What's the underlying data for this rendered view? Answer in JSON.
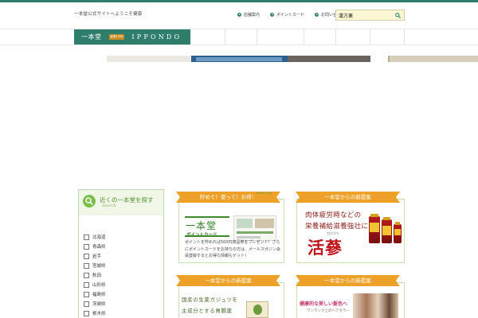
{
  "header": {
    "tagline": "一本堂公式サイトへようこそ健康",
    "links": [
      {
        "label": "店舗案内",
        "icon": "arrow-circle-icon"
      },
      {
        "label": "ポイントカード",
        "icon": "arrow-circle-icon"
      },
      {
        "label": "お問い合わせ",
        "icon": "arrow-circle-icon"
      }
    ],
    "search": {
      "value": "漢方薬",
      "icon": "search-icon"
    }
  },
  "nav": {
    "logo_kanji": "一本堂",
    "logo_since": "創業1958",
    "logo_latin": "IPPONDO",
    "items": [
      "",
      "",
      "",
      "",
      "",
      "",
      ""
    ]
  },
  "sidebar": {
    "title": "近くの一本堂を探す",
    "subtitle": "Search",
    "stores": [
      "北海道",
      "青森県",
      "岩手",
      "宮城県",
      "秋田",
      "山形県",
      "福島県",
      "茨城県",
      "栃木県"
    ]
  },
  "cards": {
    "point": {
      "ribbon": "貯めて！使って！お得！",
      "ribbon_tag": "Point Card",
      "logo_big": "一本堂",
      "logo_small": "ポイントカード",
      "body": "ポイントを貯めれば500円商品券をプレゼント！さらにポイントカードをお持ちの方は、メールマガジン会員登録するとお得な情報もゲット！"
    },
    "kajin": {
      "ribbon": "一本堂からの新提案",
      "line1": "肉体疲労時などの",
      "line2": "栄養補給滋養強壮に",
      "kana": "カツジン",
      "big": "活蔘"
    },
    "tea": {
      "ribbon": "一本堂からの新提案",
      "line1": "国産の生薬ガジュツを",
      "line2": "主成分とする胃腸薬"
    },
    "hair": {
      "ribbon": "一本堂からの新提案",
      "line1": "健康的な美しい髪色へ",
      "line2": "ワンランク上のヘアカラー"
    }
  },
  "colors": {
    "brand_green": "#2f7d6b",
    "ribbon_orange": "#eea129",
    "accent_light_green": "#7cbf4a",
    "accent_red": "#c0161e"
  }
}
